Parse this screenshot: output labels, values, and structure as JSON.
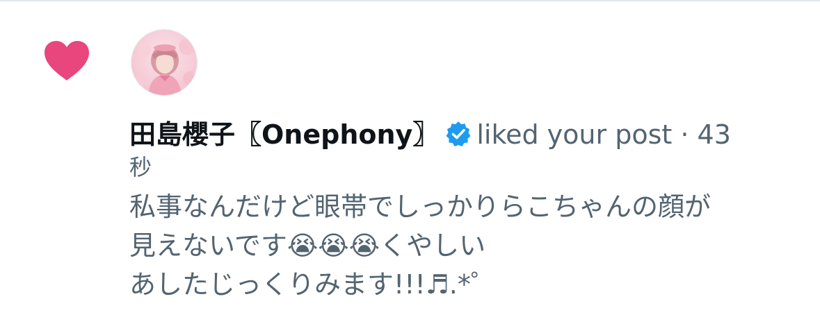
{
  "notification": {
    "user_name": "田島櫻子〖Onephony〗",
    "action_text": "liked your post",
    "separator": "·",
    "time_value": "43",
    "time_unit": "秒",
    "post_lines": [
      "私事なんだけど眼帯でしっかりらこちゃんの顔が",
      "見えないです😭😭😭くやしい",
      "あしたじっくりみます!!!♬.*゜"
    ]
  },
  "icons": {
    "heart": "heart-icon",
    "verified": "verified-badge-icon",
    "avatar": "avatar"
  },
  "colors": {
    "heart": "#e8467c",
    "verified": "#1d9bf0",
    "name": "#0f1419",
    "secondary_text": "#536471"
  }
}
